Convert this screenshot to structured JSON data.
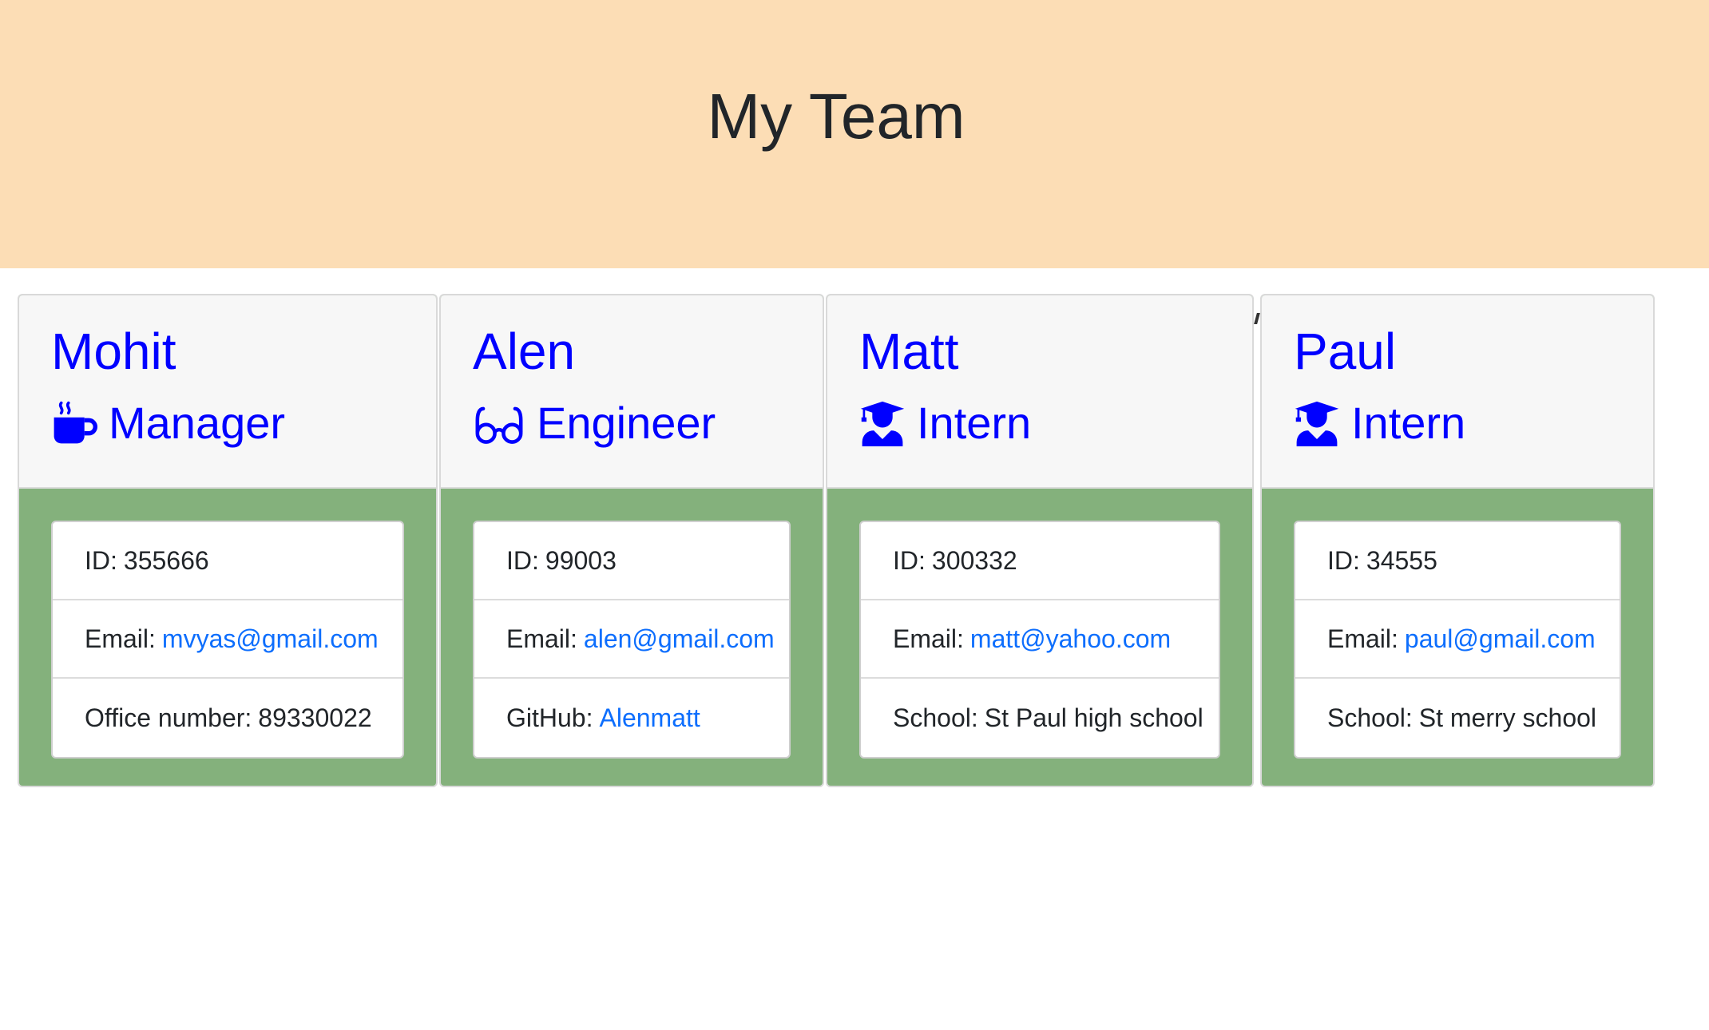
{
  "header": {
    "title": "My Team"
  },
  "members": [
    {
      "name": "Mohit",
      "role": "Manager",
      "role_icon": "coffee-mug-icon",
      "id_label": "ID:",
      "id": "355666",
      "email_label": "Email:",
      "email": "mvyas@gmail.com",
      "extra_label": "Office number:",
      "extra": "89330022"
    },
    {
      "name": "Alen",
      "role": "Engineer",
      "role_icon": "glasses-icon",
      "id_label": "ID:",
      "id": "99003",
      "email_label": "Email:",
      "email": "alen@gmail.com",
      "extra_label": "GitHub:",
      "extra": "Alenmatt"
    },
    {
      "name": "Matt",
      "role": "Intern",
      "role_icon": "graduate-icon",
      "id_label": "ID:",
      "id": "300332",
      "email_label": "Email:",
      "email": "matt@yahoo.com",
      "extra_label": "School:",
      "extra": "St Paul high school"
    },
    {
      "name": "Paul",
      "role": "Intern",
      "role_icon": "graduate-icon",
      "id_label": "ID:",
      "id": "34555",
      "email_label": "Email:",
      "email": "paul@gmail.com",
      "extra_label": "School:",
      "extra": "St merry school"
    }
  ],
  "colors": {
    "header_bg": "#fcddb5",
    "card_body_bg": "#84b17c",
    "name_color": "#0000ff",
    "link_color": "#0d6efd"
  }
}
